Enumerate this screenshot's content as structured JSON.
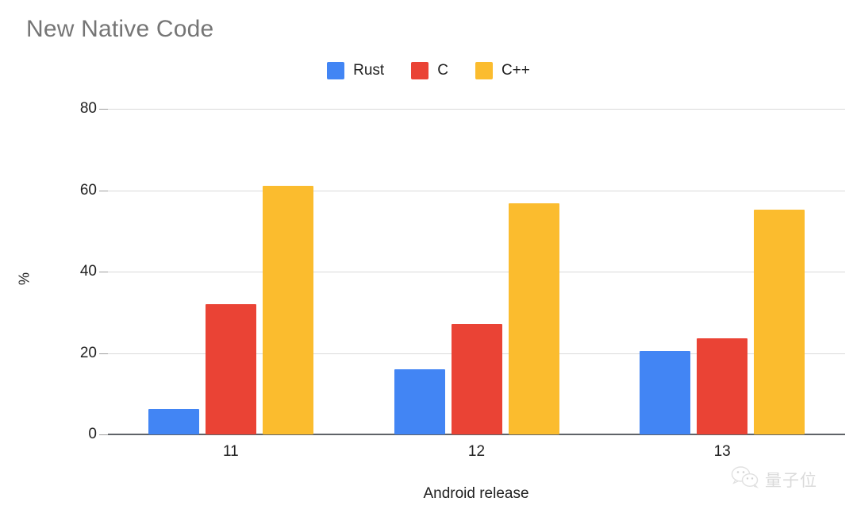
{
  "chart_data": {
    "type": "bar",
    "title": "New Native Code",
    "xlabel": "Android release",
    "ylabel": "%",
    "categories": [
      "11",
      "12",
      "13"
    ],
    "series": [
      {
        "name": "Rust",
        "color": "#4285F4",
        "values": [
          6.3,
          16,
          20.5
        ]
      },
      {
        "name": "C",
        "color": "#EA4335",
        "values": [
          32,
          27.2,
          23.6
        ]
      },
      {
        "name": "C++",
        "color": "#FBBC2E",
        "values": [
          61,
          56.8,
          55.2
        ]
      }
    ],
    "ylim": [
      0,
      80
    ],
    "yticks": [
      "0",
      "20",
      "40",
      "60",
      "80"
    ],
    "ytick_values": [
      0,
      20,
      40,
      60,
      80
    ],
    "grid": true,
    "legend_position": "top-center"
  },
  "watermark": {
    "icon": "wechat-icon",
    "text": "量子位"
  },
  "colors": {
    "title": "#757575",
    "axis": "#5f6368",
    "gridline": "#dadada",
    "tick_text": "#212121",
    "background": "#ffffff"
  }
}
